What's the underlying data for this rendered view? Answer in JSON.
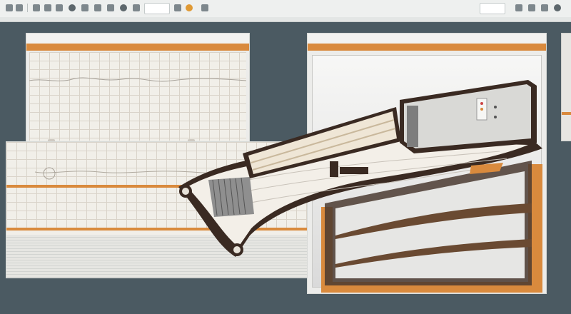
{
  "colors": {
    "background": "#4b5a62",
    "accent": "#d98a3d",
    "panel": "#ececea",
    "grid": "#d9d3c9"
  },
  "toolbar": {
    "icons": [
      "file-icon",
      "open-icon",
      "save-icon",
      "undo-icon",
      "redo-icon",
      "cut-icon",
      "copy-icon",
      "paste-icon",
      "zoom-icon",
      "grid-icon",
      "measure-icon",
      "layers-icon",
      "settings-icon",
      "record-icon"
    ],
    "right_icons": [
      "minimize-icon",
      "restore-icon",
      "close-icon"
    ]
  },
  "panels": {
    "left": {
      "name": "left-drawing-panel"
    },
    "right": {
      "name": "right-drawing-panel"
    }
  }
}
